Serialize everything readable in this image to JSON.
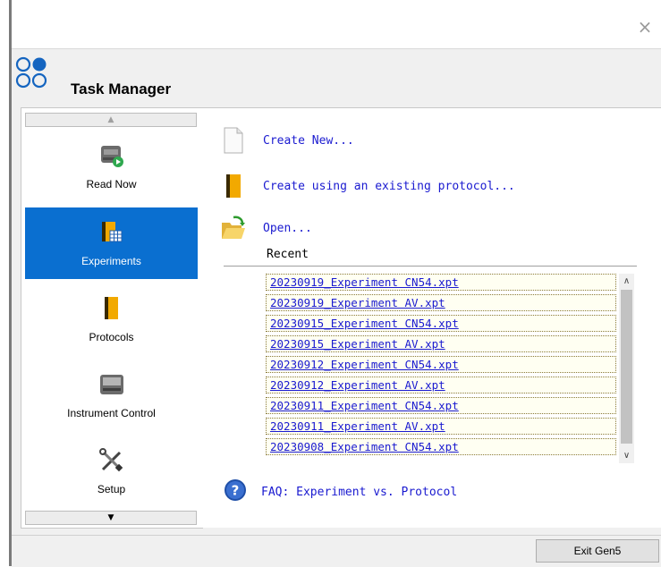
{
  "window": {
    "close_glyph": "×",
    "title": "Task Manager"
  },
  "colors": {
    "accent": "#0a6fd0",
    "link": "#1a1ad0",
    "logo": "#1565c0"
  },
  "sidebar": {
    "items": [
      {
        "label": "Read Now",
        "icon": "read-now-icon",
        "active": false
      },
      {
        "label": "Experiments",
        "icon": "experiments-icon",
        "active": true
      },
      {
        "label": "Protocols",
        "icon": "protocols-icon",
        "active": false
      },
      {
        "label": "Instrument Control",
        "icon": "instrument-icon",
        "active": false
      },
      {
        "label": "Setup",
        "icon": "setup-tools-icon",
        "active": false
      }
    ]
  },
  "actions": {
    "create_new": "Create New...",
    "create_existing": "Create using an existing protocol...",
    "open": "Open..."
  },
  "recent": {
    "label": "Recent",
    "files": [
      "20230919_Experiment CN54.xpt",
      "20230919_Experiment AV.xpt",
      "20230915_Experiment CN54.xpt",
      "20230915_Experiment AV.xpt",
      "20230912_Experiment CN54.xpt",
      "20230912_Experiment AV.xpt",
      "20230911_Experiment CN54.xpt",
      "20230911_Experiment AV.xpt",
      "20230908_Experiment CN54.xpt"
    ]
  },
  "faq": {
    "label": "FAQ: Experiment vs. Protocol"
  },
  "footer": {
    "exit_label": "Exit Gen5"
  }
}
